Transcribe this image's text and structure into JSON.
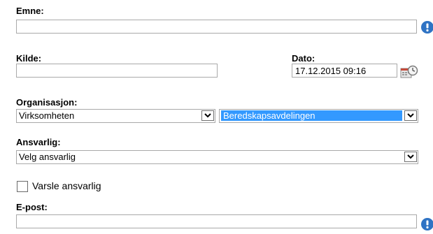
{
  "form": {
    "emne": {
      "label": "Emne:",
      "value": ""
    },
    "kilde": {
      "label": "Kilde:",
      "value": ""
    },
    "dato": {
      "label": "Dato:",
      "value": "17.12.2015 09:16"
    },
    "organisasjon": {
      "label": "Organisasjon:",
      "select1_value": "Virksomheten",
      "select2_value": "Beredskapsavdelingen"
    },
    "ansvarlig": {
      "label": "Ansvarlig:",
      "value": "Velg ansvarlig"
    },
    "varsle": {
      "label": "Varsle ansvarlig",
      "checked": false
    },
    "epost": {
      "label": "E-post:",
      "value": ""
    }
  },
  "icons": {
    "info": "info-icon",
    "calendar": "calendar-clock-icon",
    "dropdown": "chevron-down-icon"
  },
  "colors": {
    "info_blue": "#2f73c4",
    "selection": "#3399ff"
  }
}
